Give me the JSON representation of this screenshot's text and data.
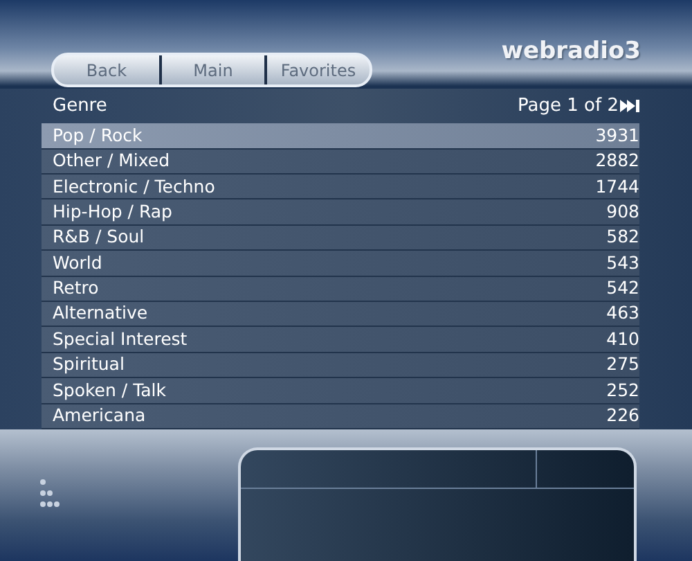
{
  "logo": "webradio3",
  "nav": [
    {
      "label": "Back"
    },
    {
      "label": "Main"
    },
    {
      "label": "Favorites"
    }
  ],
  "list_header": {
    "title": "Genre",
    "page": "Page 1 of 2"
  },
  "rows": [
    {
      "name": "Pop / Rock",
      "count": "3931",
      "selected": true
    },
    {
      "name": "Other / Mixed",
      "count": "2882",
      "selected": false
    },
    {
      "name": "Electronic / Techno",
      "count": "1744",
      "selected": false
    },
    {
      "name": "Hip-Hop / Rap",
      "count": "908",
      "selected": false
    },
    {
      "name": "R&B / Soul",
      "count": "582",
      "selected": false
    },
    {
      "name": "World",
      "count": "543",
      "selected": false
    },
    {
      "name": "Retro",
      "count": "542",
      "selected": false
    },
    {
      "name": "Alternative",
      "count": "463",
      "selected": false
    },
    {
      "name": "Special Interest",
      "count": "410",
      "selected": false
    },
    {
      "name": "Spiritual",
      "count": "275",
      "selected": false
    },
    {
      "name": "Spoken / Talk",
      "count": "252",
      "selected": false
    },
    {
      "name": "Americana",
      "count": "226",
      "selected": false
    }
  ]
}
